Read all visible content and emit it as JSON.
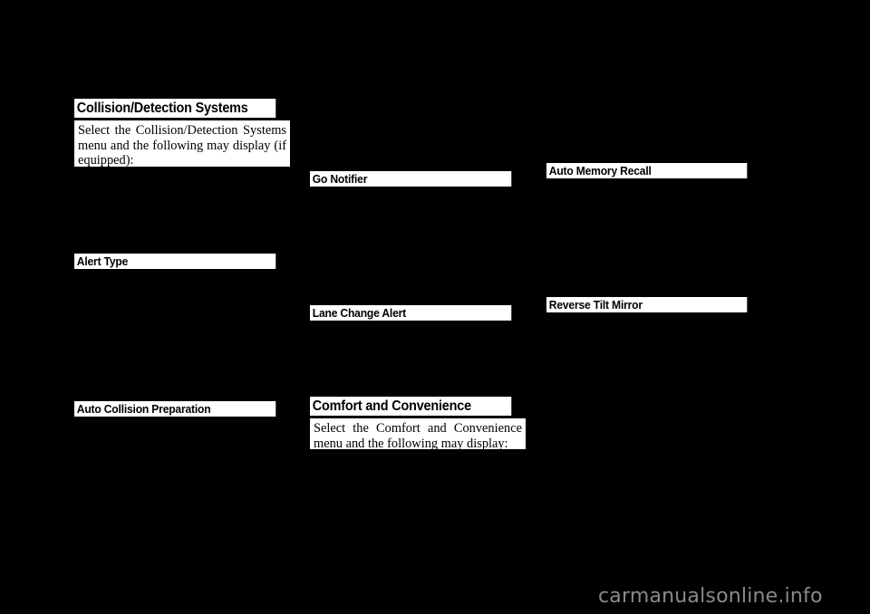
{
  "page": {
    "background_color": "#000000",
    "text_color": "#000000",
    "panel_color": "#ffffff"
  },
  "columns": {
    "left": {
      "sections": [
        {
          "heading": "Collision/Detection Systems",
          "body": "Select the Collision/Detection Systems menu and the following may display (if equipped):"
        },
        {
          "heading": "Alert Type",
          "body": ""
        },
        {
          "heading": "Auto Collision Preparation",
          "body": ""
        }
      ]
    },
    "middle": {
      "sections": [
        {
          "heading": "Go Notifier",
          "body": ""
        },
        {
          "heading": "Lane Change Alert",
          "body": ""
        },
        {
          "heading": "Comfort and Convenience",
          "body": "Select the Comfort and Convenience menu and the following may display:"
        }
      ]
    },
    "right": {
      "sections": [
        {
          "heading": "Auto Memory Recall",
          "body": ""
        },
        {
          "heading": "Reverse Tilt Mirror",
          "body": ""
        }
      ]
    }
  },
  "watermark": {
    "text": "carmanualsonline.info"
  }
}
